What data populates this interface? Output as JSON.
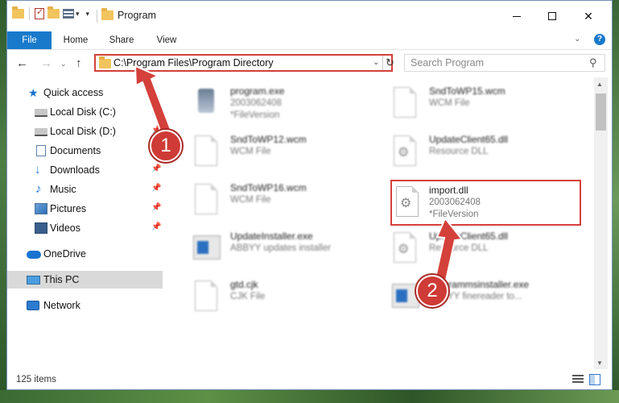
{
  "window": {
    "title": "Program"
  },
  "ribbon": {
    "tabs": [
      "File",
      "Home",
      "Share",
      "View"
    ],
    "help": "?"
  },
  "address": {
    "path": "C:\\Program Files\\Program Directory"
  },
  "search": {
    "placeholder": "Search Program"
  },
  "sidebar": {
    "items": [
      {
        "label": "Quick access"
      },
      {
        "label": "Local Disk (C:)"
      },
      {
        "label": "Local Disk (D:)"
      },
      {
        "label": "Documents"
      },
      {
        "label": "Downloads"
      },
      {
        "label": "Music"
      },
      {
        "label": "Pictures"
      },
      {
        "label": "Videos"
      },
      {
        "label": "OneDrive"
      },
      {
        "label": "This PC"
      },
      {
        "label": "Network"
      }
    ]
  },
  "files": [
    {
      "name": "program.exe",
      "line2": "2003062408",
      "line3": "*FileVersion"
    },
    {
      "name": "SndToWP15.wcm",
      "line2": "WCM File",
      "line3": ""
    },
    {
      "name": "SndToWP12.wcm",
      "line2": "WCM File",
      "line3": ""
    },
    {
      "name": "UpdateClient65.dll",
      "line2": "Resource DLL",
      "line3": ""
    },
    {
      "name": "SndToWP16.wcm",
      "line2": "WCM File",
      "line3": ""
    },
    {
      "name": "import.dll",
      "line2": "2003062408",
      "line3": "*FileVersion"
    },
    {
      "name": "UpdateInstaller.exe",
      "line2": "ABBYY updates installer",
      "line3": ""
    },
    {
      "name": "UpdateClient65.dll",
      "line2": "Resource DLL",
      "line3": ""
    },
    {
      "name": "gtd.cjk",
      "line2": "CJK File",
      "line3": ""
    },
    {
      "name": "programmsinstaller.exe",
      "line2": "ABBYY finereader to...",
      "line3": ""
    }
  ],
  "status": {
    "count": "125 items"
  },
  "annotations": {
    "step1": "1",
    "step2": "2"
  },
  "colors": {
    "accent": "#1979ca",
    "highlight": "#d4403a",
    "badge": "#cf3b36"
  }
}
